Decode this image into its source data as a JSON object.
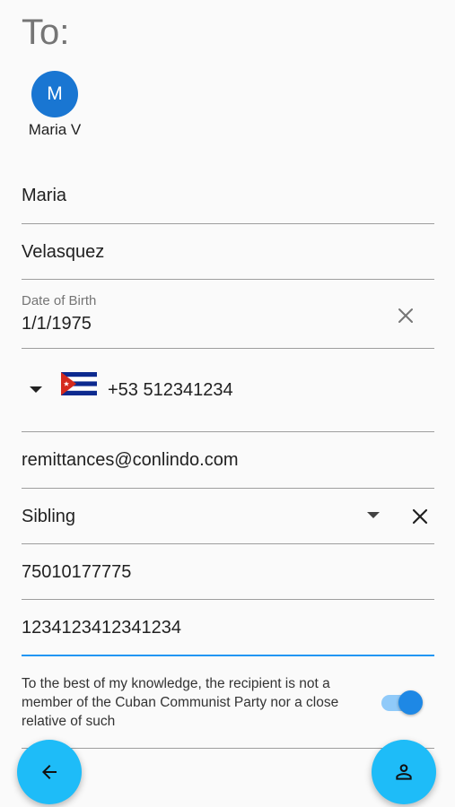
{
  "header": {
    "title": "To:"
  },
  "recipient": {
    "initial": "M",
    "name": "Maria V"
  },
  "form": {
    "first_name": "Maria",
    "last_name": "Velasquez",
    "dob_label": "Date of Birth",
    "dob_value": "1/1/1975",
    "phone": "+53 512341234",
    "email": "remittances@conlindo.com",
    "relationship": "Sibling",
    "id_number": "75010177775",
    "account_number": "1234123412341234"
  },
  "consent": {
    "text": "To the best of my knowledge, the recipient is not a member of the Cuban Communist Party nor a close relative of such",
    "checked": true
  },
  "icons": {
    "clear": "close-icon",
    "dropdown": "arrow-drop-down-icon",
    "back": "arrow-back-icon",
    "person": "person-icon",
    "flag": "cuba-flag-icon"
  },
  "colors": {
    "avatar": "#1976d2",
    "fab": "#1ebcf8",
    "accent": "#2196f3",
    "switch_thumb": "#1e88e5",
    "switch_track": "#90caf9"
  }
}
